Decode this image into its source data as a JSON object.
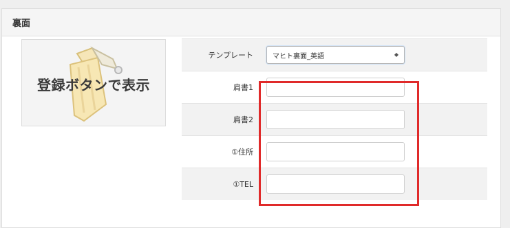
{
  "panel": {
    "title": "裏面"
  },
  "preview": {
    "label": "登録ボタンで表示"
  },
  "form": {
    "template": {
      "label": "テンプレート",
      "selected": "マヒト裏面_英語"
    },
    "fields": [
      {
        "label": "肩書1",
        "value": ""
      },
      {
        "label": "肩書2",
        "value": ""
      },
      {
        "label": "①住所",
        "value": ""
      },
      {
        "label": "①TEL",
        "value": ""
      }
    ]
  },
  "colors": {
    "highlight": "#e02a2a"
  },
  "icons": {
    "select_arrow": "up-down-caret-icon",
    "illustration": "pen-nib-icon"
  }
}
